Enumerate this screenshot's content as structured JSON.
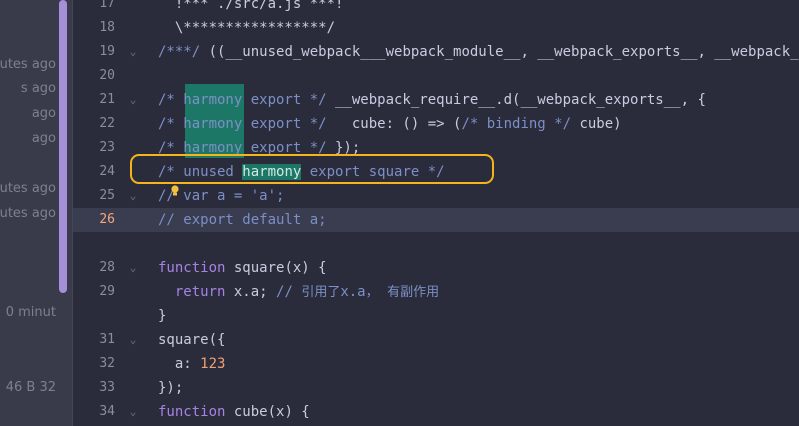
{
  "left_panel": {
    "times": [
      "utes ago",
      "s ago",
      "ago",
      "ago",
      "utes ago",
      "utes ago",
      "0 minut",
      "46 B 32"
    ]
  },
  "editor": {
    "current_line": 26,
    "lines": [
      {
        "n": "17",
        "fold": false,
        "text": "  !*** ./src/a.js ***!"
      },
      {
        "n": "18",
        "fold": false,
        "text": "  \\*****************/"
      },
      {
        "n": "19",
        "fold": true,
        "text": "/***/ ((__unused_webpack___webpack_module__, __webpack_exports__, __webpack_"
      },
      {
        "n": "20",
        "fold": false,
        "text": ""
      },
      {
        "n": "21",
        "fold": true,
        "text": "/* harmony export */ __webpack_require__.d(__webpack_exports__, {"
      },
      {
        "n": "22",
        "fold": false,
        "text": "/* harmony export */   cube: () => (/* binding */ cube)"
      },
      {
        "n": "23",
        "fold": false,
        "text": "/* harmony export */ });"
      },
      {
        "n": "24",
        "fold": false,
        "text": "/* unused harmony export square */"
      },
      {
        "n": "25",
        "fold": true,
        "text": "// var a = 'a';"
      },
      {
        "n": "26",
        "fold": false,
        "text": "// export default a;"
      },
      {
        "n": "",
        "fold": false,
        "text": ""
      },
      {
        "n": "28",
        "fold": true,
        "text": "function square(x) {"
      },
      {
        "n": "29",
        "fold": false,
        "text": "  return x.a; // 引用了x.a， 有副作用"
      },
      {
        "n": "",
        "fold": false,
        "text": "}"
      },
      {
        "n": "31",
        "fold": true,
        "text": "square({"
      },
      {
        "n": "32",
        "fold": false,
        "text": "  a: 123"
      },
      {
        "n": "33",
        "fold": false,
        "text": "});"
      },
      {
        "n": "34",
        "fold": true,
        "text": "function cube(x) {"
      }
    ]
  },
  "colors": {
    "background": "#2b2c3b",
    "current_line": "#3a3c50",
    "highlight": "#1d7766",
    "annotation_box": "#f3b41c",
    "comment": "#7c8fc7",
    "keyword": "#a782e4",
    "number": "#f1a073",
    "scroll_thumb": "#a58fd9"
  }
}
